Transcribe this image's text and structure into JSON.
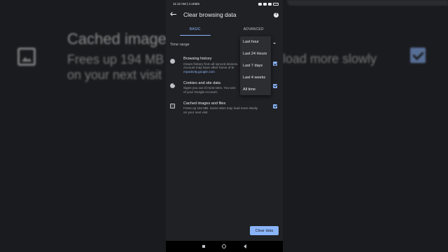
{
  "background": {
    "title": "Cached images",
    "sub_left": "Frees up 194 MB",
    "sub_right": "load more slowly",
    "sub_line2": "on your next visit"
  },
  "status_bar": {
    "time_speed": "11:12 AM | 4.1KB/s"
  },
  "app_bar": {
    "title": "Clear browsing data"
  },
  "tabs": [
    {
      "label": "BASIC",
      "active": true
    },
    {
      "label": "ADVANCED",
      "active": false
    }
  ],
  "time_range": {
    "label": "Time range",
    "options": [
      "Last hour",
      "Last 24 Hours",
      "Last 7 days",
      "Last 4 weeks",
      "All time"
    ]
  },
  "items": [
    {
      "title": "Browsing history",
      "desc": "Clears history from all synced devices.",
      "desc2": "Account may have other forms of br",
      "link": "myactivity.google.com",
      "checked": true
    },
    {
      "title": "Cookies and site data",
      "desc": "Signs you out of most sites. You won",
      "desc2": "of your Google Account.",
      "checked": true
    },
    {
      "title": "Cached images and files",
      "desc": "Frees up 194 MB. Some sites may load more slowly",
      "desc2": "on your next visit.",
      "checked": true
    }
  ],
  "clear_button": {
    "label": "Clear data"
  },
  "colors": {
    "accent": "#8ab4f8",
    "surface": "#202124",
    "menu": "#2d2e31"
  }
}
